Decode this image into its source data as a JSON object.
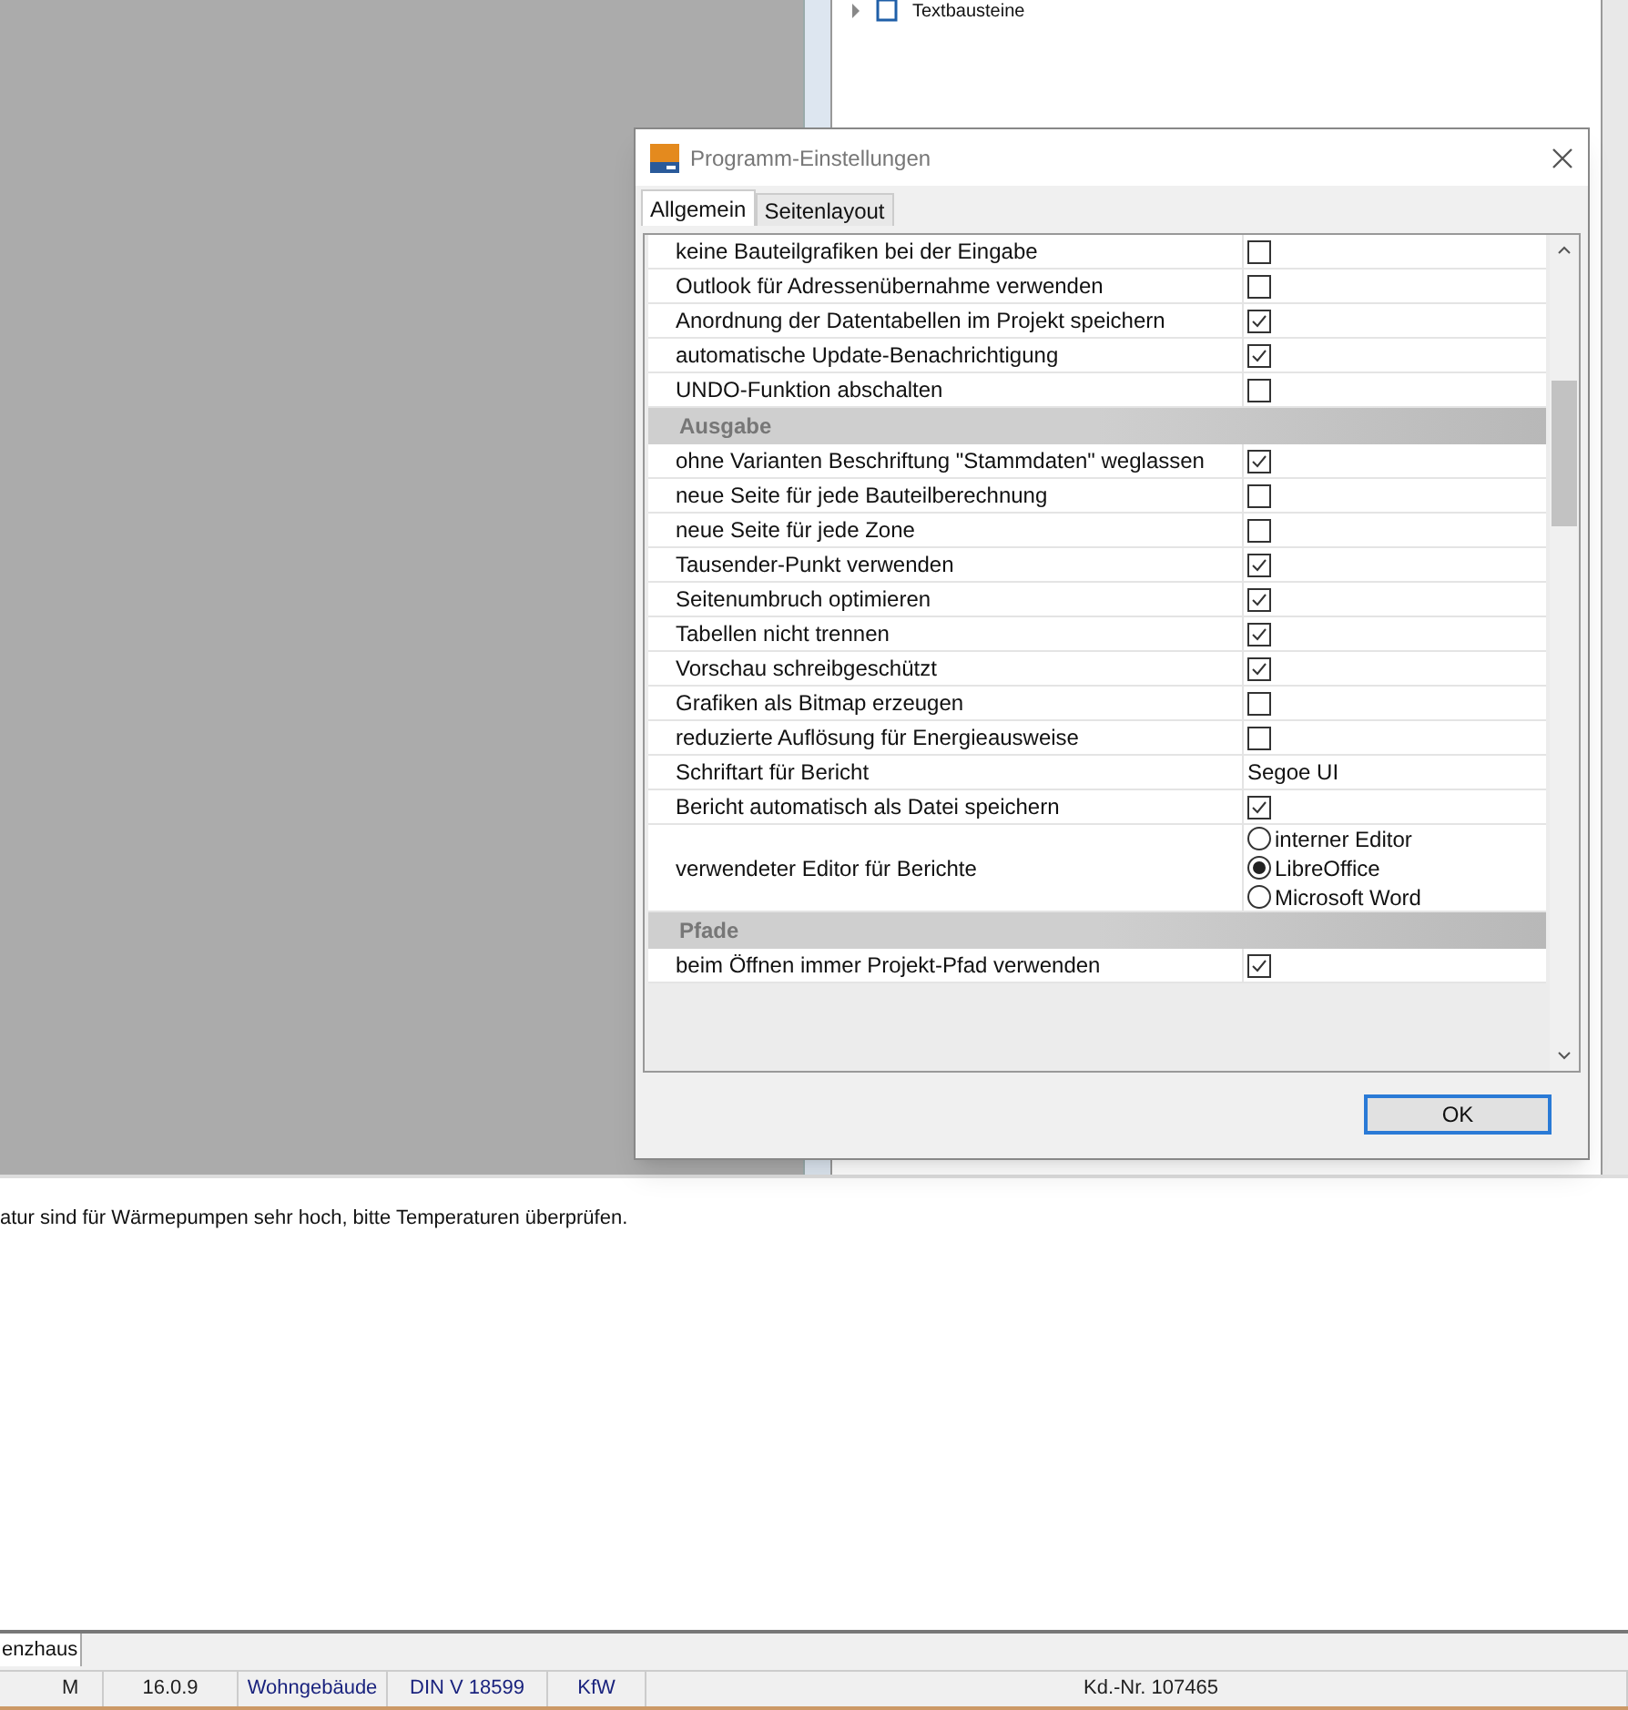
{
  "background_panel": {
    "tree_item": "Textbausteine"
  },
  "dialog": {
    "title": "Programm-Einstellungen",
    "tabs": [
      {
        "label": "Allgemein",
        "selected": true
      },
      {
        "label": "Seitenlayout",
        "selected": false
      }
    ],
    "rows": [
      {
        "kind": "checkbox",
        "label": "keine Bauteilgrafiken bei der Eingabe",
        "checked": false
      },
      {
        "kind": "checkbox",
        "label": "Outlook für Adressenübernahme verwenden",
        "checked": false
      },
      {
        "kind": "checkbox",
        "label": "Anordnung der Datentabellen im Projekt speichern",
        "checked": true
      },
      {
        "kind": "checkbox",
        "label": "automatische Update-Benachrichtigung",
        "checked": true
      },
      {
        "kind": "checkbox",
        "label": "UNDO-Funktion abschalten",
        "checked": false
      },
      {
        "kind": "section",
        "label": "Ausgabe"
      },
      {
        "kind": "checkbox",
        "label": "ohne Varianten Beschriftung \"Stammdaten\" weglassen",
        "checked": true
      },
      {
        "kind": "checkbox",
        "label": "neue Seite für jede Bauteilberechnung",
        "checked": false
      },
      {
        "kind": "checkbox",
        "label": "neue Seite für jede Zone",
        "checked": false
      },
      {
        "kind": "checkbox",
        "label": "Tausender-Punkt verwenden",
        "checked": true
      },
      {
        "kind": "checkbox",
        "label": "Seitenumbruch optimieren",
        "checked": true
      },
      {
        "kind": "checkbox",
        "label": "Tabellen nicht trennen",
        "checked": true
      },
      {
        "kind": "checkbox",
        "label": "Vorschau schreibgeschützt",
        "checked": true
      },
      {
        "kind": "checkbox",
        "label": "Grafiken als Bitmap erzeugen",
        "checked": false
      },
      {
        "kind": "checkbox",
        "label": "reduzierte Auflösung für Energieausweise",
        "checked": false
      },
      {
        "kind": "text",
        "label": "Schriftart für Bericht",
        "value": "Segoe UI"
      },
      {
        "kind": "checkbox",
        "label": "Bericht automatisch als Datei speichern",
        "checked": true
      },
      {
        "kind": "radio",
        "label": "verwendeter Editor für Berichte",
        "options": [
          {
            "label": "interner Editor",
            "selected": false
          },
          {
            "label": "LibreOffice",
            "selected": true
          },
          {
            "label": "Microsoft Word",
            "selected": false
          }
        ]
      },
      {
        "kind": "section",
        "label": "Pfade"
      },
      {
        "kind": "checkbox",
        "label": "beim Öffnen immer Projekt-Pfad verwenden",
        "checked": true
      }
    ],
    "ok_button": "OK"
  },
  "message": "atur sind für Wärmepumpen sehr hoch, bitte Temperaturen überprüfen.",
  "bottom_tabs": [
    {
      "label": "enzhaus",
      "selected": true
    }
  ],
  "status_bar": [
    {
      "text": "M",
      "kind": "plain"
    },
    {
      "text": "16.0.9",
      "kind": "plain"
    },
    {
      "text": "Wohngebäude",
      "kind": "link"
    },
    {
      "text": "DIN V 18599",
      "kind": "link"
    },
    {
      "text": "KfW",
      "kind": "link"
    },
    {
      "text": "Kd.-Nr. 107465",
      "kind": "plain"
    }
  ]
}
